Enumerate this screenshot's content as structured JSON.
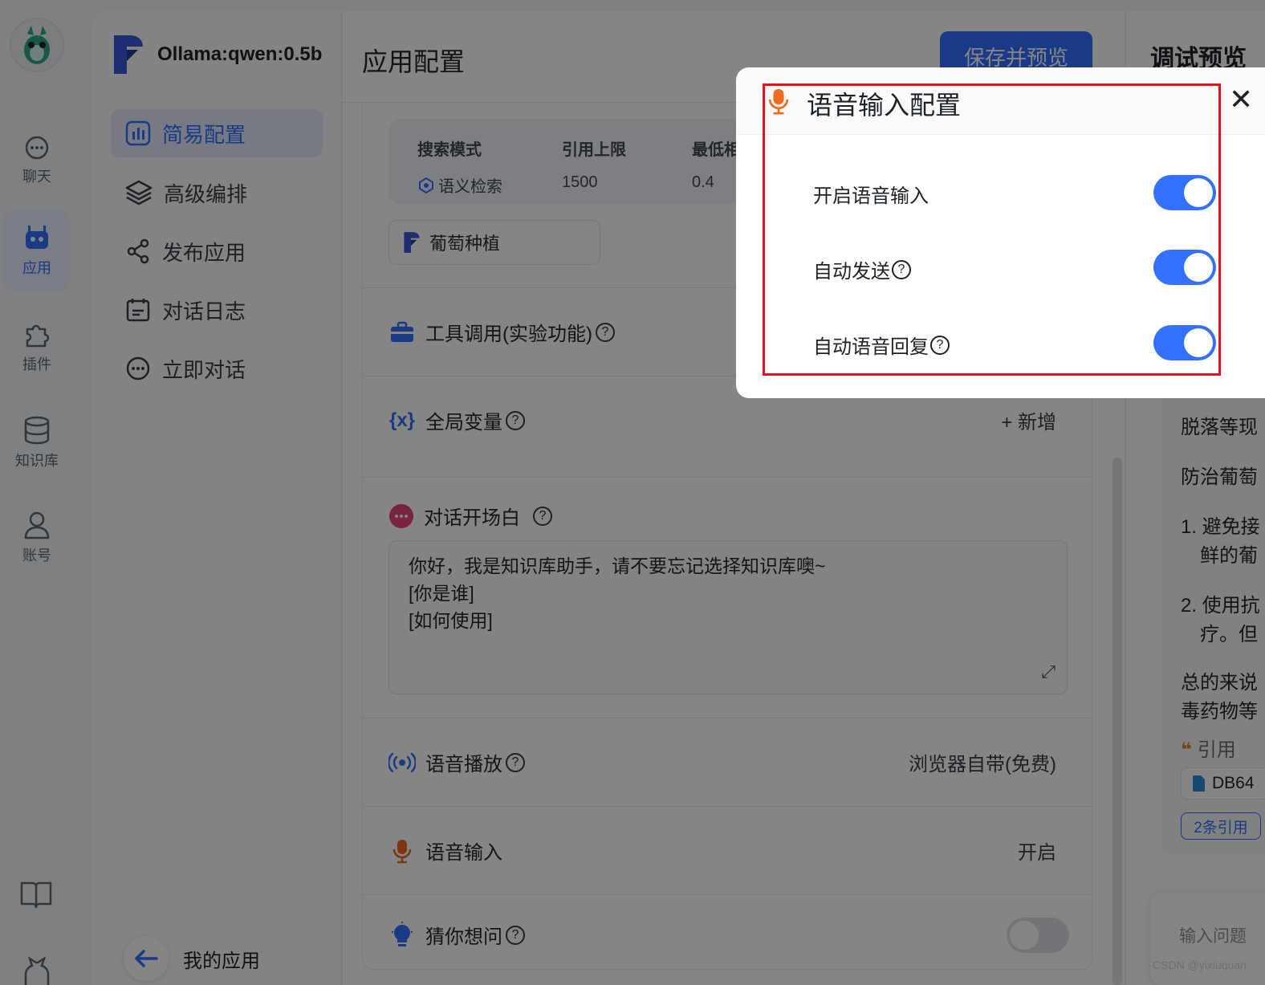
{
  "nav": {
    "items": [
      {
        "label": "聊天",
        "icon": "chat-icon"
      },
      {
        "label": "应用",
        "icon": "robot-icon"
      },
      {
        "label": "插件",
        "icon": "puzzle-icon"
      },
      {
        "label": "知识库",
        "icon": "database-icon"
      },
      {
        "label": "账号",
        "icon": "user-icon"
      }
    ],
    "active": "应用"
  },
  "sidebar": {
    "app_name": "Ollama:qwen:0.5b",
    "menu": [
      {
        "label": "简易配置",
        "icon": "chart-icon"
      },
      {
        "label": "高级编排",
        "icon": "layers-icon"
      },
      {
        "label": "发布应用",
        "icon": "share-icon"
      },
      {
        "label": "对话日志",
        "icon": "calendar-icon"
      },
      {
        "label": "立即对话",
        "icon": "chat-icon"
      }
    ],
    "back_label": "我的应用"
  },
  "main": {
    "title": "应用配置",
    "save_button": "保存并预览",
    "kb_search": {
      "headers": [
        "搜索模式",
        "引用上限",
        "最低相"
      ],
      "values": [
        "语义检索",
        "1500",
        "0.4"
      ]
    },
    "kb_chip": "葡萄种植",
    "tools_label": "工具调用(实验功能)",
    "variables_label": "全局变量",
    "variables_add": "+ 新增",
    "opening_label": "对话开场白",
    "opening_lines": [
      "你好，我是知识库助手，请不要忘记选择知识库噢~",
      "[你是谁]",
      "[如何使用]"
    ],
    "tts_label": "语音播放",
    "tts_value": "浏览器自带(免费)",
    "voice_input_label": "语音输入",
    "voice_input_value": "开启",
    "guess_label": "猜你想问"
  },
  "preview": {
    "title": "调试预览",
    "lines": [
      "脱落等现",
      "防治葡萄",
      "1. 避免接",
      "鲜的葡",
      "2. 使用抗",
      "疗。但",
      "总的来说",
      "毒药物等"
    ],
    "quote_label": "引用",
    "db_chip": "DB64",
    "cite_chip": "2条引用",
    "input_placeholder": "输入问题"
  },
  "modal": {
    "title": "语音输入配置",
    "close": "✕",
    "settings": [
      {
        "label": "开启语音输入",
        "on": true,
        "help": false
      },
      {
        "label": "自动发送",
        "on": true,
        "help": true
      },
      {
        "label": "自动语音回复",
        "on": true,
        "help": true
      }
    ]
  },
  "colors": {
    "accent": "#3370ff",
    "highlight": "#e0141e",
    "mic": "#f06a1f"
  },
  "watermark": "CSDN @yixiuquan"
}
